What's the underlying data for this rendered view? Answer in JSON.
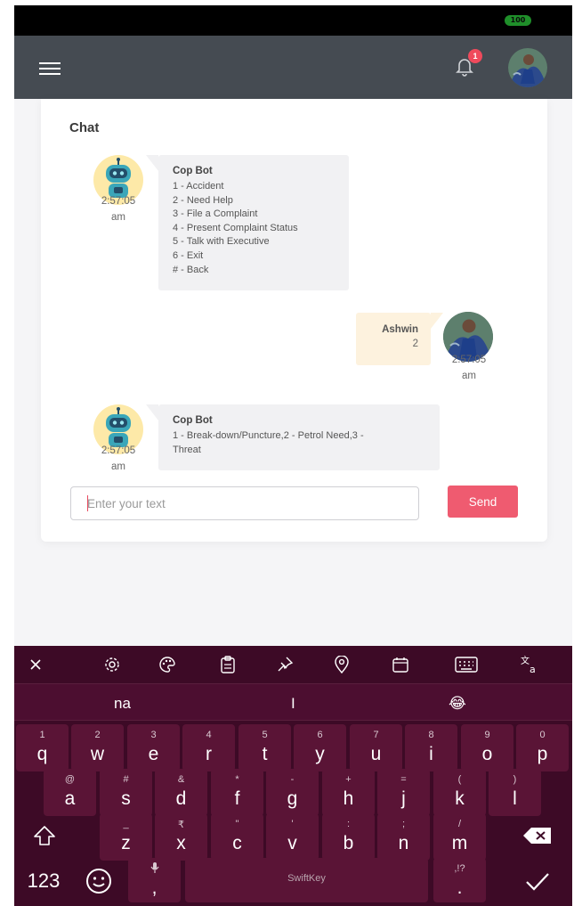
{
  "status_bar": {
    "battery": "100"
  },
  "header": {
    "notification_count": "1"
  },
  "chat": {
    "title": "Chat",
    "messages": [
      {
        "sender": "Cop Bot",
        "time_line1": "2:57:05",
        "time_line2": "am",
        "lines": [
          "1 - Accident",
          "2 - Need Help",
          "3 - File a Complaint",
          "4 - Present Complaint Status",
          "5 - Talk with Executive",
          "6 - Exit",
          "# - Back"
        ]
      },
      {
        "sender": "Ashwin",
        "value": "2",
        "time_line1": "2:57:05",
        "time_line2": "am"
      },
      {
        "sender": "Cop Bot",
        "time_line1": "2:57:05",
        "time_line2": "am",
        "lines": [
          "1 - Break-down/Puncture,2 - Petrol Need,3 -",
          "Threat"
        ]
      }
    ],
    "input": {
      "placeholder": "Enter your text",
      "value": ""
    },
    "send_label": "Send"
  },
  "keyboard": {
    "toolbar_icons": [
      "close-icon",
      "gear-icon",
      "palette-icon",
      "clipboard-icon",
      "pin-icon",
      "location-icon",
      "calendar-icon",
      "keyboard-icon",
      "translate-icon"
    ],
    "suggestions": [
      "na",
      "I",
      "😂"
    ],
    "row1": [
      {
        "alt": "1",
        "main": "q"
      },
      {
        "alt": "2",
        "main": "w"
      },
      {
        "alt": "3",
        "main": "e"
      },
      {
        "alt": "4",
        "main": "r"
      },
      {
        "alt": "5",
        "main": "t"
      },
      {
        "alt": "6",
        "main": "y"
      },
      {
        "alt": "7",
        "main": "u"
      },
      {
        "alt": "8",
        "main": "i"
      },
      {
        "alt": "9",
        "main": "o"
      },
      {
        "alt": "0",
        "main": "p"
      }
    ],
    "row2": [
      {
        "alt": "@",
        "main": "a"
      },
      {
        "alt": "#",
        "main": "s"
      },
      {
        "alt": "&",
        "main": "d"
      },
      {
        "alt": "*",
        "main": "f"
      },
      {
        "alt": "-",
        "main": "g"
      },
      {
        "alt": "+",
        "main": "h"
      },
      {
        "alt": "=",
        "main": "j"
      },
      {
        "alt": "(",
        "main": "k"
      },
      {
        "alt": ")",
        "main": "l"
      }
    ],
    "row3": [
      {
        "alt": "_",
        "main": "z"
      },
      {
        "alt": "₹",
        "main": "x"
      },
      {
        "alt": "\"",
        "main": "c"
      },
      {
        "alt": "'",
        "main": "v"
      },
      {
        "alt": ":",
        "main": "b"
      },
      {
        "alt": ";",
        "main": "n"
      },
      {
        "alt": "/",
        "main": "m"
      }
    ],
    "numbers_label": "123",
    "comma_label": ",",
    "space_label": "SwiftKey",
    "punct_alt": ",!?",
    "period_label": "."
  }
}
